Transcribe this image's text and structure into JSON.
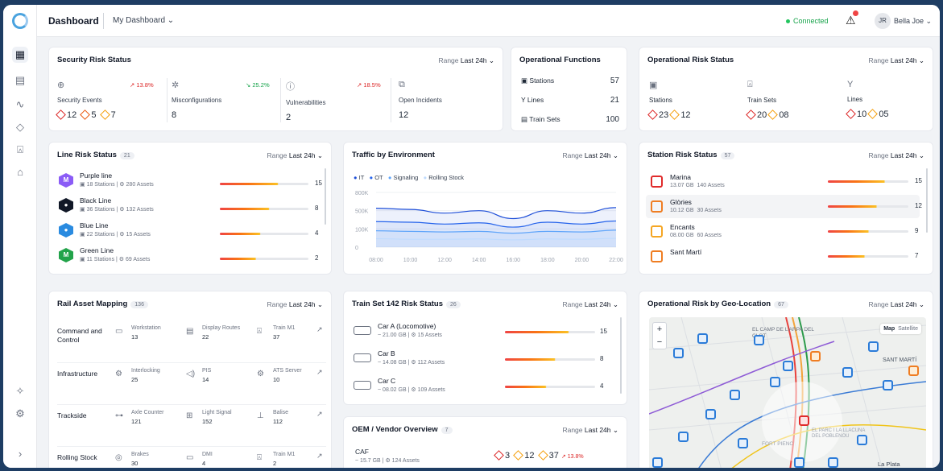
{
  "topbar": {
    "title": "Dashboard",
    "dashboard_select": "My Dashboard ⌄",
    "connection": "Connected",
    "avatar_initials": "JR",
    "user_name": "Bella Joe ⌄"
  },
  "security": {
    "title": "Security Risk Status",
    "range_label": "Range",
    "range_value": "Last 24h ⌄",
    "items": [
      {
        "label": "Security Events",
        "change": "↗ 13.8%",
        "values": [
          "12",
          "5",
          "7"
        ]
      },
      {
        "label": "Misconfigurations",
        "change": "↘ 25.2%",
        "value": "8"
      },
      {
        "label": "Vulnerabilities",
        "change": "↗ 18.5%",
        "value": "2"
      },
      {
        "label": "Open Incidents",
        "value": "12"
      }
    ]
  },
  "opfunc": {
    "title": "Operational Functions",
    "rows": [
      {
        "label": "Stations",
        "value": "57"
      },
      {
        "label": "Lines",
        "value": "21"
      },
      {
        "label": "Train Sets",
        "value": "100"
      }
    ]
  },
  "oprisk": {
    "title": "Operational Risk Status",
    "range_label": "Range",
    "range_value": "Last 24h ⌄",
    "items": [
      {
        "label": "Stations",
        "a": "23",
        "b": "12"
      },
      {
        "label": "Train Sets",
        "a": "20",
        "b": "08"
      },
      {
        "label": "Lines",
        "a": "10",
        "b": "05"
      }
    ]
  },
  "linerisk": {
    "title": "Line Risk Status",
    "count": "21",
    "range_label": "Range",
    "range_value": "Last 24h ⌄",
    "rows": [
      {
        "name": "Purple line",
        "stations": "18 Stations",
        "assets": "280 Assets",
        "value": "15",
        "color": "#8b5cf6",
        "letter": "M",
        "fill": 0.65
      },
      {
        "name": "Black Line",
        "stations": "36 Stations",
        "assets": "132 Assets",
        "value": "8",
        "color": "#111827",
        "letter": "●",
        "fill": 0.55
      },
      {
        "name": "Blue Line",
        "stations": "22 Stations",
        "assets": "15 Assets",
        "value": "4",
        "color": "#2a8be0",
        "letter": "●",
        "fill": 0.45
      },
      {
        "name": "Green Line",
        "stations": "11 Stations",
        "assets": "69 Assets",
        "value": "2",
        "color": "#22a34a",
        "letter": "M",
        "fill": 0.4
      }
    ]
  },
  "traffic": {
    "title": "Traffic by Environment",
    "range_label": "Range",
    "range_value": "Last 24h ⌄",
    "legend": [
      {
        "name": "IT",
        "color": "#1d4ed8"
      },
      {
        "name": "OT",
        "color": "#2563eb"
      },
      {
        "name": "Signaling",
        "color": "#60a5fa"
      },
      {
        "name": "Rolling Stock",
        "color": "#bfdbfe"
      }
    ],
    "yticks": [
      "800K",
      "500K",
      "100K",
      "0"
    ],
    "xticks": [
      "08:00",
      "10:00",
      "12:00",
      "14:00",
      "16:00",
      "18:00",
      "20:00",
      "22:00"
    ]
  },
  "chart_data": {
    "type": "area",
    "title": "Traffic by Environment",
    "categories": [
      "08:00",
      "10:00",
      "12:00",
      "14:00",
      "16:00",
      "18:00",
      "20:00",
      "22:00"
    ],
    "series": [
      {
        "name": "IT",
        "values": [
          640,
          620,
          560,
          600,
          470,
          600,
          560,
          650
        ]
      },
      {
        "name": "OT",
        "values": [
          420,
          410,
          380,
          400,
          330,
          410,
          380,
          430
        ]
      },
      {
        "name": "Signaling",
        "values": [
          270,
          260,
          250,
          260,
          230,
          260,
          250,
          280
        ]
      },
      {
        "name": "Rolling Stock",
        "values": [
          140,
          130,
          130,
          135,
          120,
          135,
          130,
          145
        ]
      }
    ],
    "ylim": [
      0,
      900
    ]
  },
  "station": {
    "title": "Station Risk Status",
    "count": "57",
    "range_label": "Range",
    "range_value": "Last 24h ⌄",
    "rows": [
      {
        "name": "Marina",
        "size": "13.07 GB",
        "assets": "140 Assets",
        "value": "15",
        "color": "#e02b2b",
        "fill": 0.7
      },
      {
        "name": "Glòries",
        "size": "10.12 GB",
        "assets": "30 Assets",
        "value": "12",
        "color": "#ef7d22",
        "fill": 0.6
      },
      {
        "name": "Encants",
        "size": "08.00 GB",
        "assets": "60 Assets",
        "value": "9",
        "color": "#f5a623",
        "fill": 0.5
      },
      {
        "name": "Sant Martí",
        "size": "",
        "assets": "",
        "value": "7",
        "color": "#ef7d22",
        "fill": 0.45
      }
    ]
  },
  "asset": {
    "title": "Rail Asset Mapping",
    "count": "136",
    "range_label": "Range",
    "range_value": "Last 24h ⌄",
    "groups": [
      {
        "name": "Command and Control",
        "items": [
          {
            "label": "Workstation",
            "value": "13"
          },
          {
            "label": "Display Routes",
            "value": "22"
          },
          {
            "label": "Train M1",
            "value": "37"
          }
        ]
      },
      {
        "name": "Infrastructure",
        "items": [
          {
            "label": "Interlocking",
            "value": "25"
          },
          {
            "label": "PIS",
            "value": "14"
          },
          {
            "label": "ATS Server",
            "value": "10"
          }
        ]
      },
      {
        "name": "Trackside",
        "items": [
          {
            "label": "Axle Counter",
            "value": "121"
          },
          {
            "label": "Light Signal",
            "value": "152"
          },
          {
            "label": "Balise",
            "value": "112"
          }
        ]
      },
      {
        "name": "Rolling Stock",
        "items": [
          {
            "label": "Brakes",
            "value": "30"
          },
          {
            "label": "DMI",
            "value": "4"
          },
          {
            "label": "Train M1",
            "value": "2"
          }
        ]
      }
    ]
  },
  "trainset": {
    "title": "Train Set 142 Risk Status",
    "count": "26",
    "range_label": "Range",
    "range_value": "Last 24h ⌄",
    "rows": [
      {
        "name": "Car A (Locomotive)",
        "size": "21.00 GB",
        "assets": "15 Assets",
        "value": "15",
        "fill": 0.7
      },
      {
        "name": "Car B",
        "size": "14.08 GB",
        "assets": "112 Assets",
        "value": "8",
        "fill": 0.55
      },
      {
        "name": "Car C",
        "size": "08.02 GB",
        "assets": "109 Assets",
        "value": "4",
        "fill": 0.45
      }
    ]
  },
  "oem": {
    "title": "OEM / Vendor Overview",
    "count": "7",
    "range_label": "Range",
    "range_value": "Last 24h ⌄",
    "row": {
      "name": "CAF",
      "size": "15.7 GB",
      "assets": "124 Assets",
      "a": "3",
      "b": "12",
      "c": "37",
      "change": "↗ 13.8%"
    }
  },
  "geo": {
    "title": "Operational Risk by Geo-Location",
    "count": "67",
    "range_label": "Range",
    "range_value": "Last 24h ⌄",
    "map_btn": "Map",
    "sat_btn": "Satellite",
    "zoom_in": "+",
    "zoom_out": "−",
    "places": [
      "EL CAMP DE L'ARPA DEL CLOT",
      "SANT MARTÍ",
      "EL PARC I LA LLACUNA DEL POBLENOU",
      "FORT PIENC",
      "La Plata"
    ]
  }
}
